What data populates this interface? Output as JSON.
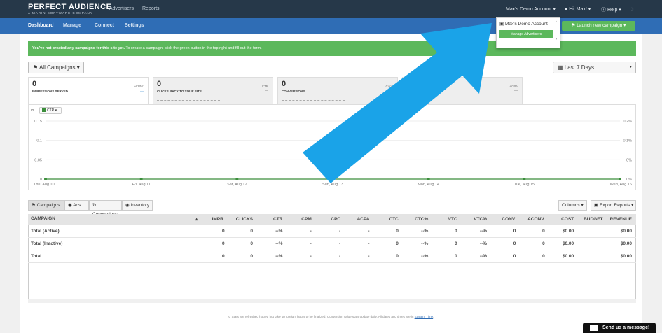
{
  "brand": {
    "name": "PERFECT AUDIENCE",
    "tagline": "A MARIN SOFTWARE COMPANY"
  },
  "topnav": {
    "advertisers": "Advertisers",
    "reports": "Reports"
  },
  "topright": {
    "account": "Max's Demo Account ▾",
    "user": "Hi, Max! ▾",
    "help": "Help ▾"
  },
  "subnav": {
    "dashboard": "Dashboard",
    "manage": "Manage",
    "connect": "Connect",
    "settings": "Settings",
    "launch": "Launch new campaign ▾"
  },
  "dropdown": {
    "account": "Max's Demo Account",
    "manage": "Manage Advertisers"
  },
  "alert": {
    "bold": "You've not created any campaigns for this site yet.",
    "text": " To create a campaign, click the green button in the top right and fill out the form."
  },
  "filters": {
    "campaigns": "All Campaigns ▾",
    "range": "Last 7 Days"
  },
  "metrics": [
    {
      "value": "0",
      "label": "IMPRESSIONS SERVED",
      "right_label": "eCPM:",
      "right_value": "—"
    },
    {
      "value": "0",
      "label": "CLICKS BACK TO YOUR SITE",
      "right_label": "CTR",
      "right_value": "—"
    },
    {
      "value": "0",
      "label": "CONVERSIONS",
      "right_label": "Conv",
      "right_value": ""
    },
    {
      "value": "",
      "label": "",
      "right_label": "eCPA",
      "right_value": "—"
    }
  ],
  "chart": {
    "vs": "vs.",
    "metric_select": "CTR ▾"
  },
  "chart_data": {
    "type": "line",
    "categories": [
      "Thu, Aug 10",
      "Fri, Aug 11",
      "Sat, Aug 12",
      "Sun, Aug 13",
      "Mon, Aug 14",
      "Tue, Aug 15",
      "Wed, Aug 16"
    ],
    "series": [
      {
        "values": [
          0,
          0,
          0,
          0,
          0,
          0,
          0
        ]
      }
    ],
    "left_ticks": [
      "0.15",
      "0.1",
      "0.05",
      "0"
    ],
    "right_ticks": [
      "0.2%",
      "0.1%",
      "0%",
      "0%"
    ],
    "ylim": [
      0,
      0.15
    ],
    "color": "#3b8e3b",
    "grid": true
  },
  "tabs": {
    "campaigns": "Campaigns",
    "ads": "Ads",
    "conversions": "Conversions",
    "inventory": "Inventory",
    "columns": "Columns ▾",
    "export": "Export Reports ▾"
  },
  "table": {
    "headers": [
      "CAMPAIGN",
      "IMPR.",
      "CLICKS",
      "CTR",
      "CPM",
      "CPC",
      "ACPA",
      "CTC",
      "CTC%",
      "VTC",
      "VTC%",
      "CONV.",
      "ACONV.",
      "COST",
      "BUDGET",
      "REVENUE"
    ],
    "rows": [
      [
        "Total (Active)",
        "0",
        "0",
        "--%",
        "-",
        "-",
        "-",
        "0",
        "--%",
        "0",
        "--%",
        "0",
        "0",
        "$0.00",
        "",
        "$0.00"
      ],
      [
        "Total (Inactive)",
        "0",
        "0",
        "--%",
        "-",
        "-",
        "-",
        "0",
        "--%",
        "0",
        "--%",
        "0",
        "0",
        "$0.00",
        "",
        "$0.00"
      ],
      [
        "Total",
        "0",
        "0",
        "--%",
        "-",
        "-",
        "-",
        "0",
        "--%",
        "0",
        "--%",
        "0",
        "0",
        "$0.00",
        "",
        "$0.00"
      ]
    ]
  },
  "footer": {
    "text": "Stats are refreshed hourly, but take up to eight hours to be finalized. Conversion value stats update daily. All dates and times are in ",
    "link": "Eastern Time"
  },
  "messenger": {
    "label": "Send us a message!"
  },
  "colors": {
    "topbar": "#263849",
    "subnav": "#2f6db5",
    "success": "#5cb85c",
    "arrow": "#1aa3e8"
  }
}
